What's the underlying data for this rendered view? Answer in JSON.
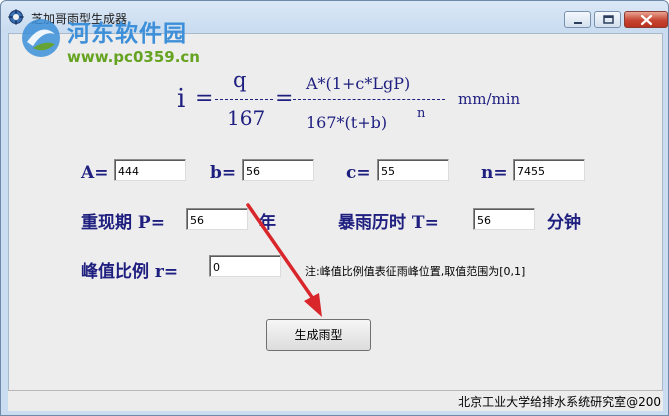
{
  "window": {
    "title": "芝加哥雨型生成器"
  },
  "watermark": {
    "site_name": "河东软件园",
    "url": "www.pc0359.cn"
  },
  "formula": {
    "lhs": "i",
    "eq": "=",
    "num1": "q",
    "den1": "167",
    "num2": "A*(1+c*LgP)",
    "den2": "167*(t+b)",
    "den2_exp": "n",
    "unit": "mm/min"
  },
  "params": {
    "A": {
      "label": "A=",
      "value": "444"
    },
    "b": {
      "label": "b=",
      "value": "56"
    },
    "c": {
      "label": "c=",
      "value": "55"
    },
    "n": {
      "label": "n=",
      "value": "7455"
    }
  },
  "return_period": {
    "label": "重现期 P=",
    "value": "56",
    "unit": "年"
  },
  "duration": {
    "label": "暴雨历时 T=",
    "value": "56",
    "unit": "分钟"
  },
  "peak_ratio": {
    "label": "峰值比例 r=",
    "value": "0",
    "note": "注:峰值比例值表征雨峰位置,取值范围为[0,1]"
  },
  "generate_button": {
    "label": "生成雨型"
  },
  "status_bar": {
    "text": "北京工业大学给排水系统研究室@200"
  },
  "colors": {
    "label_text": "#1f1f80",
    "annotation_arrow": "#d8262b",
    "watermark_blue": "#3c8fd8",
    "watermark_green": "#66a321"
  }
}
